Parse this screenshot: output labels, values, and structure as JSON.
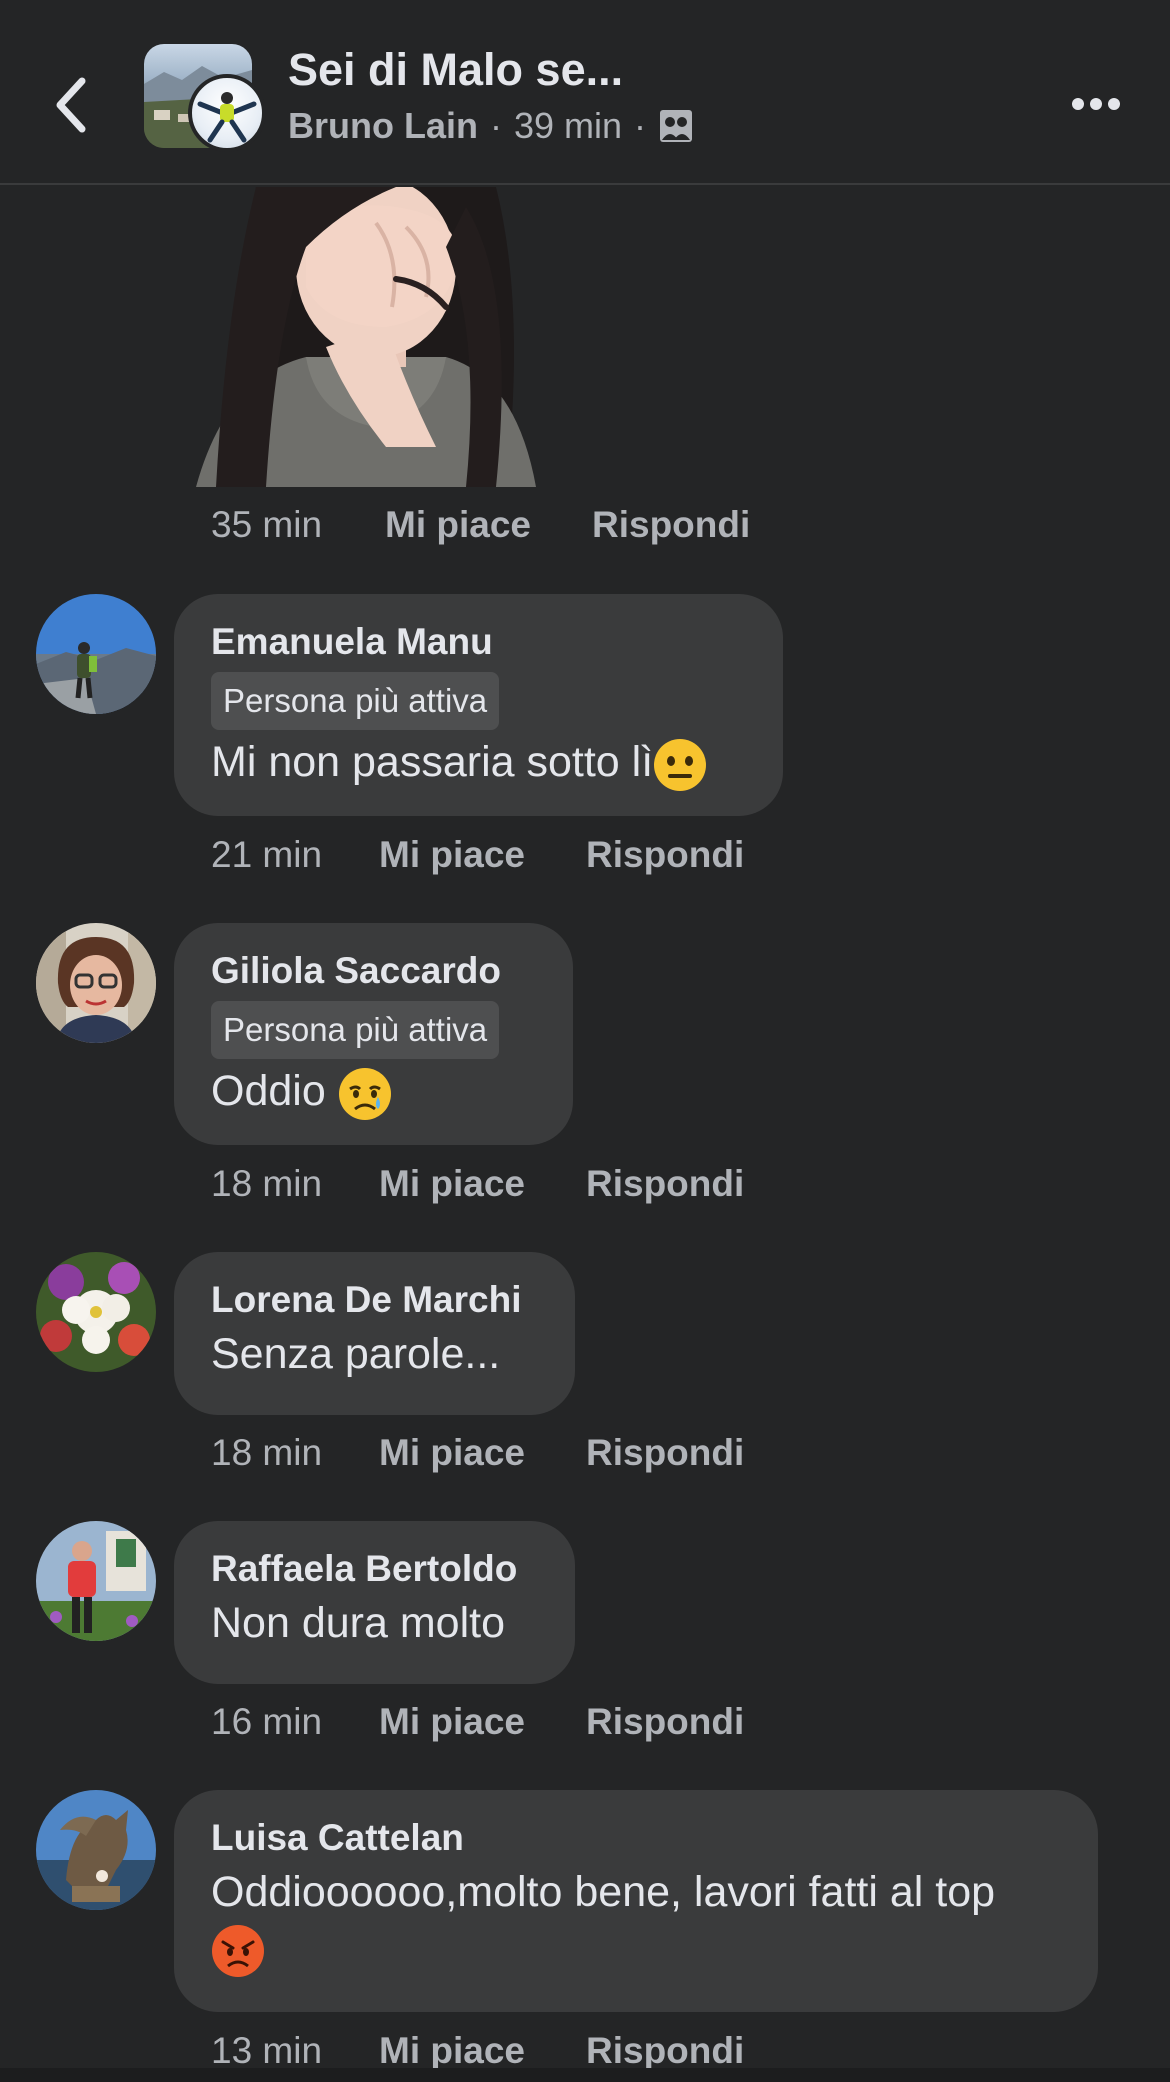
{
  "header": {
    "title": "Sei di Malo se...",
    "author": "Bruno Lain",
    "separator": "·",
    "time": "39 min",
    "audience_icon": "group-audience-icon",
    "back_icon": "chevron-left-icon",
    "more_icon": "more-horizontal-icon"
  },
  "sticker_meta": {
    "time": "35 min",
    "like": "Mi piace",
    "reply": "Rispondi"
  },
  "comments": [
    {
      "name": "Emanuela Manu",
      "badge": "Persona più attiva",
      "text": "Mi non passaria sotto lì",
      "emoji": "neutral-face-emoji",
      "time": "21 min",
      "like": "Mi piace",
      "reply": "Rispondi"
    },
    {
      "name": "Giliola Saccardo",
      "badge": "Persona più attiva",
      "text": "Oddio",
      "emoji": "sad-sweat-face-emoji",
      "time": "18 min",
      "like": "Mi piace",
      "reply": "Rispondi"
    },
    {
      "name": "Lorena De Marchi",
      "text": "Senza parole...",
      "time": "18 min",
      "like": "Mi piace",
      "reply": "Rispondi"
    },
    {
      "name": "Raffaela Bertoldo",
      "text": "Non dura molto",
      "time": "16 min",
      "like": "Mi piace",
      "reply": "Rispondi"
    },
    {
      "name": "Luisa Cattelan",
      "text": "Oddioooooo,molto bene, lavori fatti al top",
      "emoji": "angry-face-emoji",
      "time": "13 min",
      "like": "Mi piace",
      "reply": "Rispondi"
    }
  ],
  "colors": {
    "background": "#242526",
    "bubble": "#3a3b3c",
    "badge": "#4e4f50",
    "text_primary": "#e4e6eb",
    "text_secondary": "#b0b3b8"
  }
}
